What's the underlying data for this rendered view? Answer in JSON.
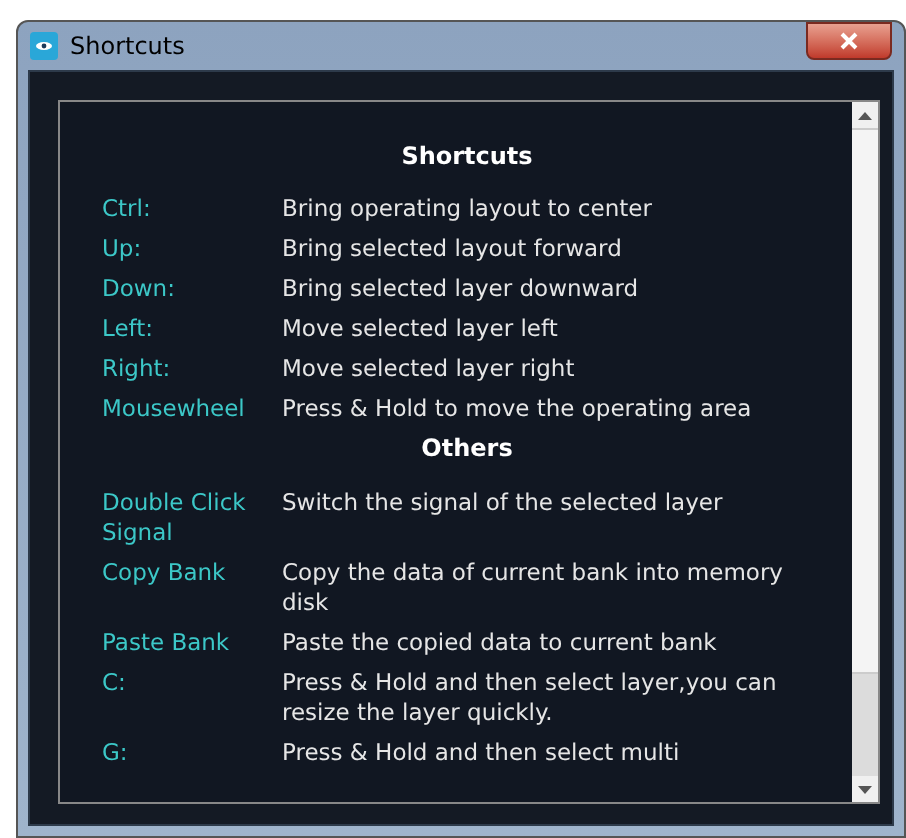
{
  "window": {
    "title": "Shortcuts"
  },
  "sections": [
    {
      "heading": "Shortcuts",
      "rows": [
        {
          "key": "Ctrl:",
          "action": "Bring operating layout to center"
        },
        {
          "key": "Up:",
          "action": "Bring selected layout forward"
        },
        {
          "key": "Down:",
          "action": "Bring selected layer downward"
        },
        {
          "key": "Left:",
          "action": "Move selected layer left"
        },
        {
          "key": "Right:",
          "action": "Move selected layer right"
        },
        {
          "key": "Mousewheel",
          "action": "Press & Hold to move the operating area"
        }
      ]
    },
    {
      "heading": "Others",
      "rows": [
        {
          "key": "Double Click Signal",
          "action": "Switch the signal of the selected layer"
        },
        {
          "key": "Copy Bank",
          "action": "Copy the data of current bank into memory disk"
        },
        {
          "key": "Paste Bank",
          "action": "Paste the copied data to current bank"
        },
        {
          "key": "C:",
          "action": "Press & Hold and then select layer,you can resize the layer quickly."
        },
        {
          "key": "G:",
          "action": "Press & Hold and then select multi"
        }
      ]
    }
  ]
}
